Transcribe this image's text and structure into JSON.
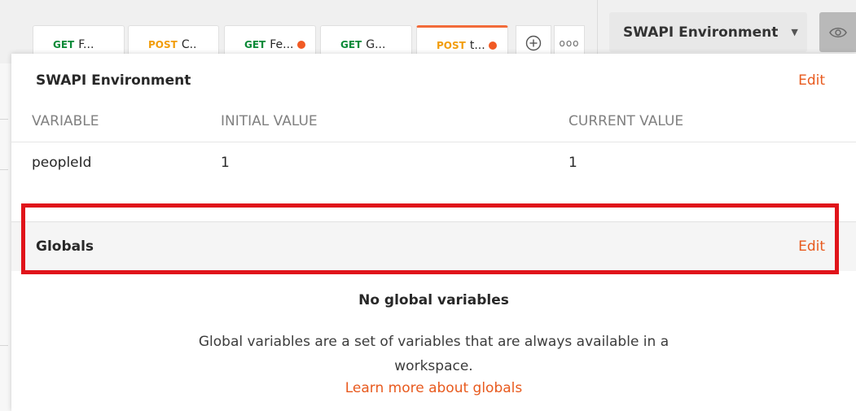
{
  "tabs": [
    {
      "method": "GET",
      "name": "F...",
      "dirty": false,
      "active": false
    },
    {
      "method": "POST",
      "name": "C..",
      "dirty": false,
      "active": false
    },
    {
      "method": "GET",
      "name": "Fe...",
      "dirty": true,
      "active": false
    },
    {
      "method": "GET",
      "name": "G...",
      "dirty": false,
      "active": false
    },
    {
      "method": "POST",
      "name": "t...",
      "dirty": true,
      "active": true
    }
  ],
  "tab_more_label": "ooo",
  "environment_selector": {
    "label": "SWAPI Environment",
    "caret_icon": "caret-down-icon"
  },
  "eye_icon": "eye-icon",
  "environment": {
    "title": "SWAPI Environment",
    "edit_label": "Edit",
    "columns": [
      "VARIABLE",
      "INITIAL VALUE",
      "CURRENT VALUE"
    ],
    "rows": [
      {
        "variable": "peopleId",
        "initial": "1",
        "current": "1"
      }
    ]
  },
  "globals": {
    "title": "Globals",
    "edit_label": "Edit",
    "empty_title": "No global variables",
    "empty_description": "Global variables are a set of variables that are always available in a workspace.",
    "learn_more": "Learn more about globals"
  },
  "colors": {
    "accent": "#e85a1e",
    "get": "#0b8a38",
    "post": "#f29d0b",
    "highlight": "#e0141a"
  }
}
